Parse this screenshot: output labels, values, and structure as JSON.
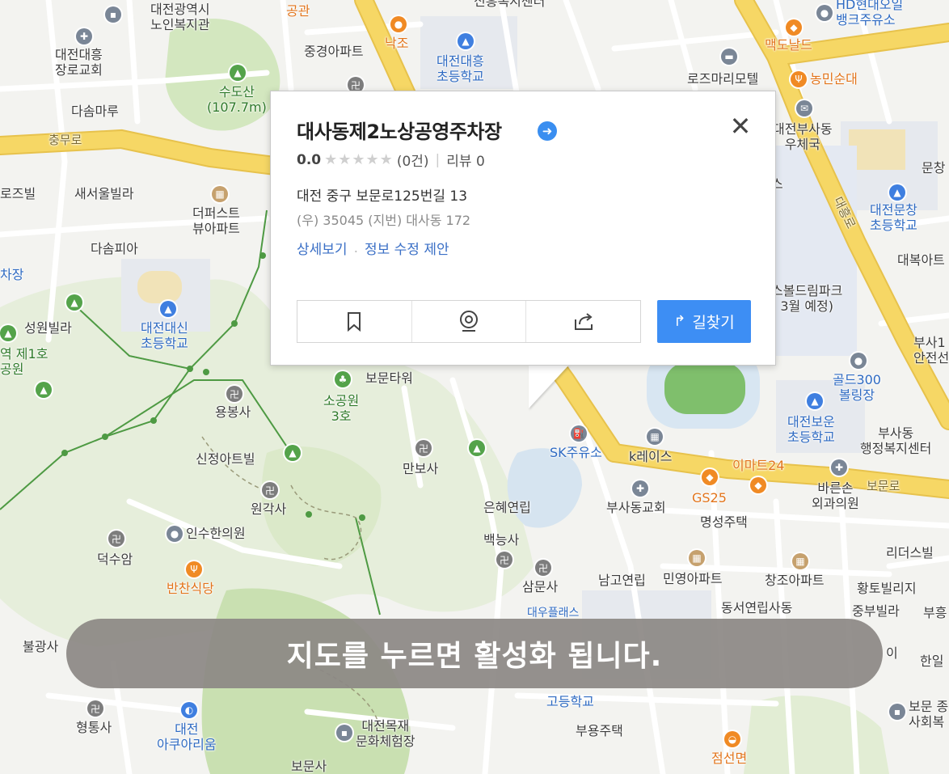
{
  "place": {
    "name": "대사동제2노상공영주차장",
    "rating": "0.0",
    "review_count_label": "(0건)",
    "review_label": "리뷰 0",
    "address": "대전 중구 보문로125번길 13",
    "zip_lot": "(우) 35045   (지번) 대사동 172",
    "link_detail": "상세보기",
    "link_edit": "정보 수정 제안",
    "route_label": "길찾기",
    "stars": "★★★★★"
  },
  "overlay_text": "지도를 누르면 활성화 됩니다.",
  "colors": {
    "road_main": "#f6d765",
    "route_button": "#3d8ef4",
    "park": "#cfe4b8",
    "water": "#cfe0ef"
  },
  "map_labels": {
    "l01": "대전광역시\n노인복지관",
    "l02": "공관",
    "l03": "신흥복지센터",
    "l04": "HD현대오일\n뱅크주유소",
    "l05": "대전대흥\n장로교회",
    "l06": "중경아파트",
    "l07": "낙조",
    "l08": "대전대흥\n초등학교",
    "l09": "맥도날드",
    "l10": "수도산\n(107.7m)",
    "l11": "로즈마리모텔",
    "l12": "농민순대",
    "l13": "다솜마루",
    "l14": "대전부사동\n우체국",
    "l15": "충무로",
    "l16": "문창",
    "l17": "로즈빌",
    "l18": "새서울빌라",
    "l19": "더퍼스트\n뷰아파트",
    "l20": "대전문창\n초등학교",
    "l21": "다솜피아",
    "l22": "대흥로",
    "l23": "대복아트",
    "l24": "차장",
    "l25": "스볼드림파크\n( 3월 예정)",
    "l26": "성원빌라",
    "l27": "대전대신\n초등학교",
    "l28": "역 제1호\n공원",
    "l29": "부사1\n안전선",
    "l30": "보문타워",
    "l31": "골드300\n볼링장",
    "l32": "소공원\n3호",
    "l33": "용봉사",
    "l34": "대전보운\n초등학교",
    "l35": "부사동\n행정복지센터",
    "l36": "SK주유소",
    "l37": "k레이스",
    "l38": "신정아트빌",
    "l39": "만보사",
    "l40": "이마트24",
    "l41": "보문로",
    "l42": "원각사",
    "l43": "은혜연립",
    "l44": "부사동교회",
    "l45": "GS25",
    "l46": "바른손\n외과의원",
    "l47": "인수한의원",
    "l48": "명성주택",
    "l49": "백능사",
    "l50": "덕수암",
    "l51": "리더스빌",
    "l52": "반찬식당",
    "l53": "삼문사",
    "l54": "남고연립",
    "l55": "민영아파트",
    "l56": "창조아파트",
    "l57": "황토빌리지",
    "l58": "대우플래스",
    "l59": "동서연립사동",
    "l60": "중부빌라",
    "l61": "부흥",
    "l62": "불광사",
    "l63": "한일",
    "l64": "고등학교",
    "l65": "형통사",
    "l66": "대전\n아쿠아리움",
    "l67": "대전목재\n문화체험장",
    "l68": "부용주택",
    "l69": "보문 종\n사회복",
    "l70": "보문사",
    "l71": "점선면",
    "l72": "스",
    "l73": "이"
  }
}
